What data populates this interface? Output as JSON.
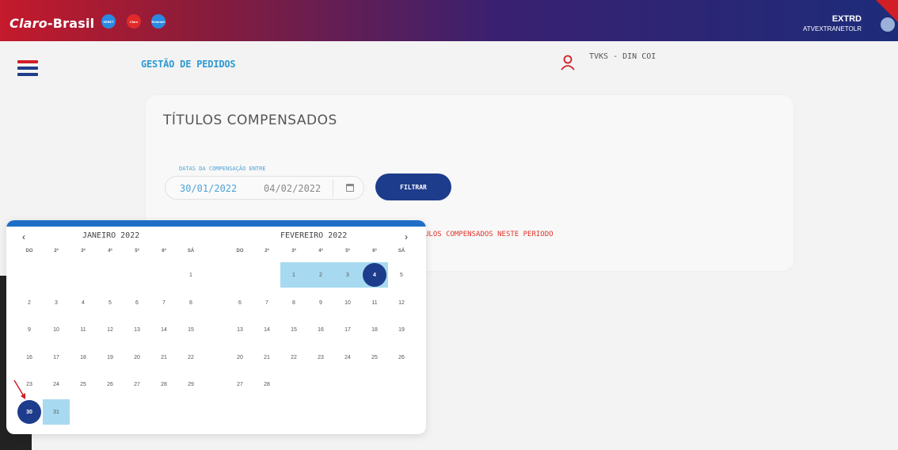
{
  "header": {
    "brand": "Claro",
    "brand_suffix": "Brasil",
    "badges": [
      "SEBET",
      "Claro",
      "Embratel"
    ],
    "user_top": "EXTRD",
    "user_sub": "ATVEXTRANETOLR"
  },
  "subheader": {
    "page_title": "GESTÃO DE PEDIDOS",
    "user_name": "TVKS - DIN COI"
  },
  "card": {
    "title": "TÍTULOS COMPENSADOS",
    "range_label": "DATAS DA COMPENSAÇÃO ENTRE",
    "start_date": "30/01/2022",
    "end_date": "04/02/2022",
    "filter_label": "FILTRAR",
    "message": "ULOS COMPENSADOS NESTE PERIODO"
  },
  "datepicker": {
    "prev": "‹",
    "next": "›",
    "weekdays": [
      "DO",
      "2ª",
      "3ª",
      "4ª",
      "5ª",
      "6ª",
      "SÁ"
    ],
    "months": [
      {
        "title": "JANEIRO 2022",
        "days": [
          "",
          "",
          "",
          "",
          "",
          "",
          "1",
          "2",
          "3",
          "4",
          "5",
          "6",
          "7",
          "8",
          "9",
          "10",
          "11",
          "12",
          "13",
          "14",
          "15",
          "16",
          "17",
          "18",
          "19",
          "20",
          "21",
          "22",
          "23",
          "24",
          "25",
          "26",
          "27",
          "28",
          "29",
          "30",
          "31",
          "",
          "",
          "",
          "",
          ""
        ],
        "selected": "30",
        "highlighted": [
          "31"
        ]
      },
      {
        "title": "FEVEREIRO 2022",
        "days": [
          "",
          "",
          "1",
          "2",
          "3",
          "4",
          "5",
          "6",
          "7",
          "8",
          "9",
          "10",
          "11",
          "12",
          "13",
          "14",
          "15",
          "16",
          "17",
          "18",
          "19",
          "20",
          "21",
          "22",
          "23",
          "24",
          "25",
          "26",
          "27",
          "28",
          "",
          "",
          "",
          "",
          ""
        ],
        "selected": "4",
        "highlighted": [
          "1",
          "2",
          "3"
        ]
      }
    ]
  },
  "colors": {
    "accent": "#2c9ad4",
    "primary": "#1e3c8c",
    "range": "#a7daf0",
    "error": "#e0362d"
  }
}
